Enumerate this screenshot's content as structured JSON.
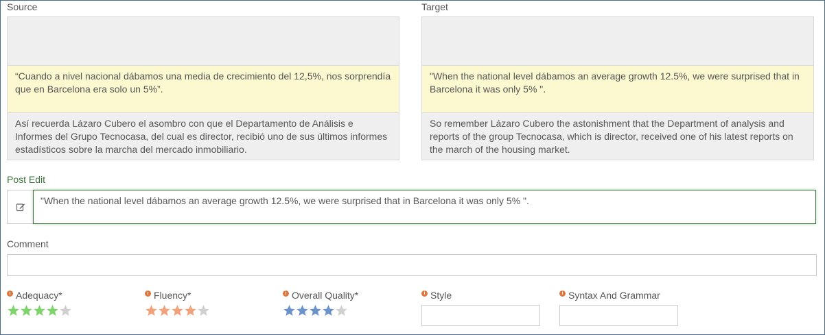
{
  "source": {
    "label": "Source",
    "prev": "",
    "current": "“Cuando a nivel nacional dábamos una media de crecimiento del 12,5%, nos sorprendía que en Barcelona era solo un 5%”.",
    "next": "Así recuerda Lázaro Cubero el asombro con que el Departamento de Análisis e Informes del Grupo Tecnocasa, del cual es director, recibió uno de sus últimos informes estadísticos sobre la marcha del mercado inmobiliario."
  },
  "target": {
    "label": "Target",
    "prev": "",
    "current": "\"When the national level dábamos an average growth 12.5%, we were surprised that in Barcelona it was only 5% \".",
    "next": "So remember Lázaro Cubero the astonishment that the Department of analysis and reports of the group Tecnocasa, which is director, received one of his latest reports on the march of the housing market."
  },
  "post_edit": {
    "label": "Post Edit",
    "icon": "edit-icon",
    "value": "\"When the national level dábamos an average growth 12.5%, we were surprised that in Barcelona it was only 5% \"."
  },
  "comment": {
    "label": "Comment",
    "value": ""
  },
  "metrics": {
    "info_icon": "info-icon",
    "adequacy": {
      "label": "Adequacy*",
      "rating": 4,
      "max": 5,
      "color": "#7ed36a"
    },
    "fluency": {
      "label": "Fluency*",
      "rating": 4,
      "max": 5,
      "color": "#f2a27b"
    },
    "overall": {
      "label": "Overall Quality*",
      "rating": 4,
      "max": 5,
      "color": "#6b93c9"
    },
    "style": {
      "label": "Style",
      "value": ""
    },
    "syntax": {
      "label": "Syntax And Grammar",
      "value": ""
    },
    "empty_star_color": "#d0d0d0"
  }
}
